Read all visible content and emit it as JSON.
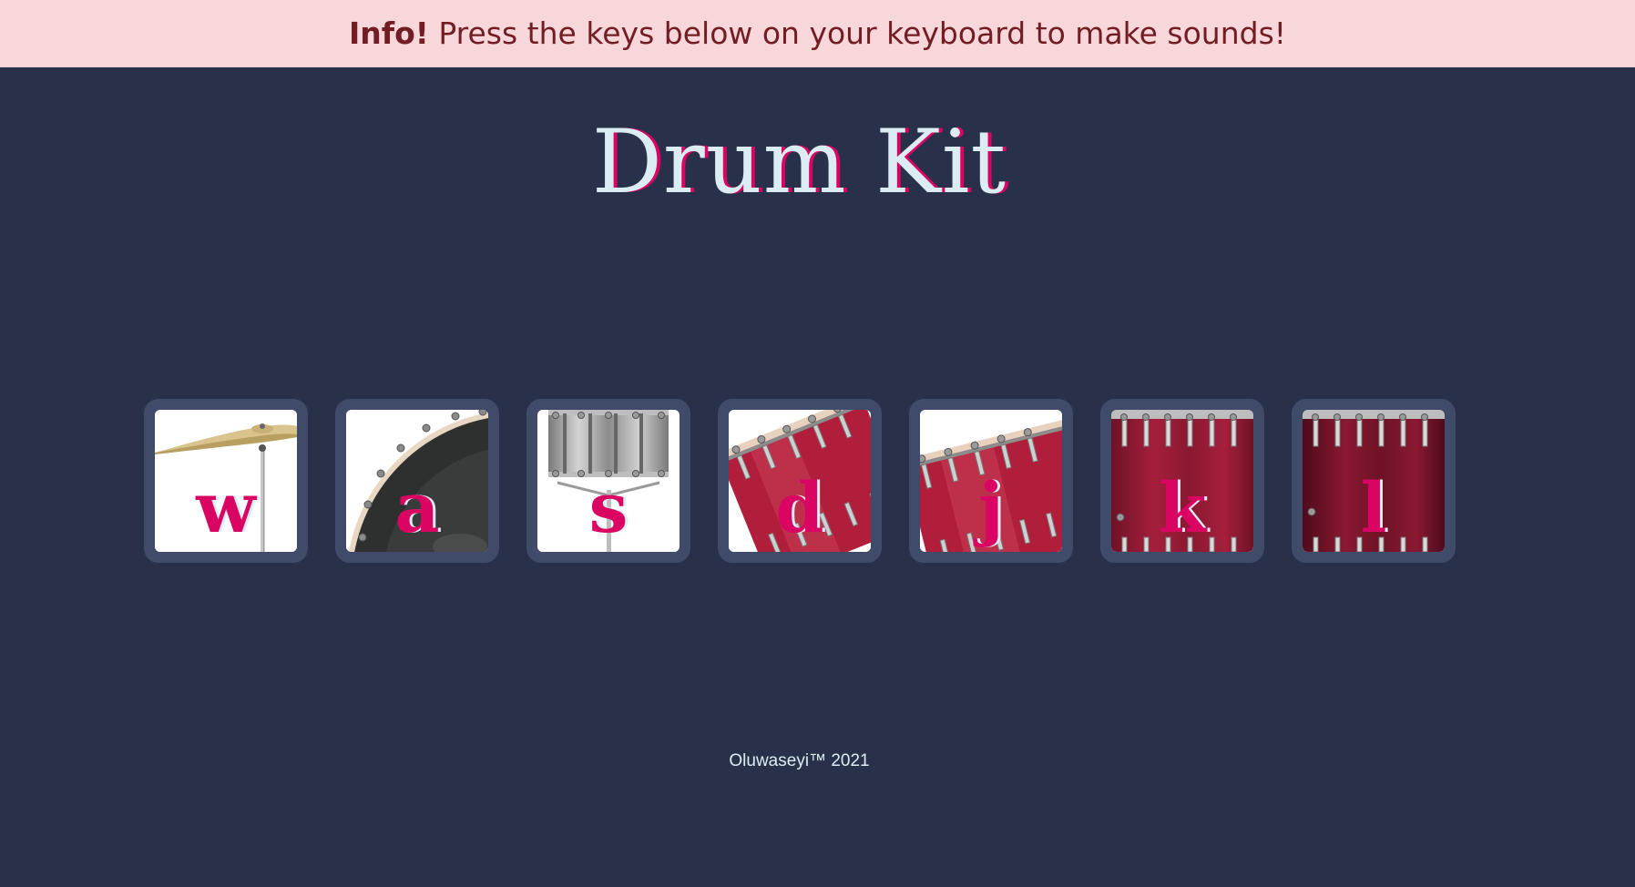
{
  "alert": {
    "label": "Info!",
    "message": " Press the keys below on your keyboard to make sounds!"
  },
  "title": "Drum Kit",
  "drums": [
    {
      "key": "w",
      "image": "crash-cymbal"
    },
    {
      "key": "a",
      "image": "kick-bass"
    },
    {
      "key": "s",
      "image": "snare"
    },
    {
      "key": "d",
      "image": "tom-1"
    },
    {
      "key": "j",
      "image": "tom-2"
    },
    {
      "key": "k",
      "image": "tom-3"
    },
    {
      "key": "l",
      "image": "tom-4"
    }
  ],
  "footer": "Oluwaseyi™ 2021",
  "colors": {
    "background": "#283149",
    "button_border": "#404b69",
    "accent": "#da0463",
    "light": "#dbedf3",
    "alert_bg": "#f8d7da",
    "alert_text": "#721c24"
  }
}
